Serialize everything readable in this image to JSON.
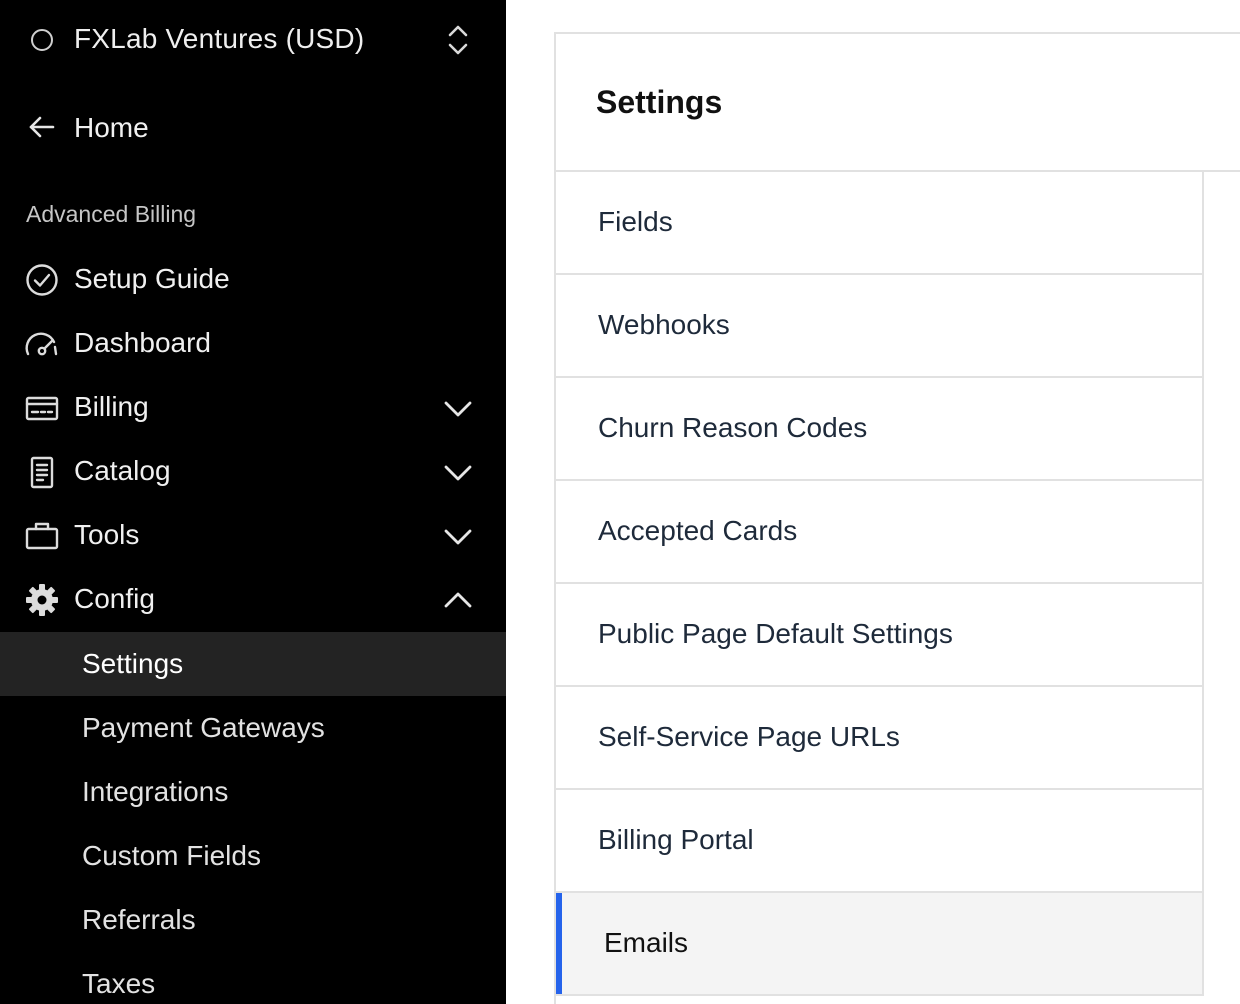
{
  "sidebar": {
    "org_name": "FXLab Ventures (USD)",
    "home_label": "Home",
    "section_label": "Advanced Billing",
    "items": [
      {
        "label": "Setup Guide",
        "icon": "check-circle-icon"
      },
      {
        "label": "Dashboard",
        "icon": "gauge-icon"
      },
      {
        "label": "Billing",
        "icon": "card-icon",
        "expanded": false
      },
      {
        "label": "Catalog",
        "icon": "document-icon",
        "expanded": false
      },
      {
        "label": "Tools",
        "icon": "briefcase-icon",
        "expanded": false
      },
      {
        "label": "Config",
        "icon": "gear-icon",
        "expanded": true
      }
    ],
    "config_children": [
      {
        "label": "Settings",
        "active": true
      },
      {
        "label": "Payment Gateways"
      },
      {
        "label": "Integrations"
      },
      {
        "label": "Custom Fields"
      },
      {
        "label": "Referrals"
      },
      {
        "label": "Taxes"
      }
    ]
  },
  "main": {
    "title": "Settings",
    "rows": [
      {
        "label": "Fields"
      },
      {
        "label": "Webhooks"
      },
      {
        "label": "Churn Reason Codes"
      },
      {
        "label": "Accepted Cards"
      },
      {
        "label": "Public Page Default Settings"
      },
      {
        "label": "Self-Service Page URLs"
      },
      {
        "label": "Billing Portal"
      },
      {
        "label": "Emails",
        "active": true
      }
    ]
  },
  "colors": {
    "sidebar_bg": "#000000",
    "sidebar_active_bg": "#232323",
    "accent": "#2563eb",
    "row_active_bg": "#f4f4f4"
  }
}
